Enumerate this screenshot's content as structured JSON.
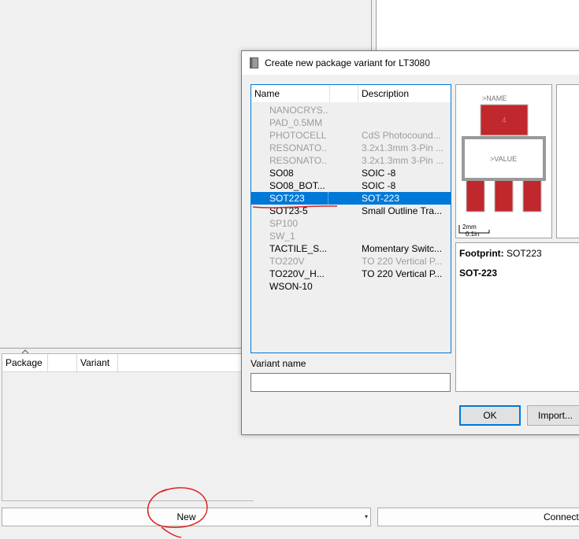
{
  "background": {
    "package_table": {
      "columns": [
        "Package",
        "",
        "Variant",
        ""
      ]
    },
    "new_combo": {
      "label": "New",
      "arrow": "▾"
    },
    "connect_button": {
      "label": "Connect"
    }
  },
  "dialog": {
    "title": "Create new package variant for LT3080",
    "columns": {
      "name": "Name",
      "spacer": "",
      "description": "Description"
    },
    "rows": [
      {
        "name": "NANOCRYS...",
        "description": "",
        "enabled": false
      },
      {
        "name": "PAD_0.5MM",
        "description": "",
        "enabled": false
      },
      {
        "name": "PHOTOCELL",
        "description": "CdS Photocound...",
        "enabled": false
      },
      {
        "name": "RESONATO...",
        "description": "3.2x1.3mm 3-Pin ...",
        "enabled": false
      },
      {
        "name": "RESONATO...",
        "description": "3.2x1.3mm 3-Pin ...",
        "enabled": false
      },
      {
        "name": "SO08",
        "description": "SOIC -8",
        "enabled": true
      },
      {
        "name": "SO08_BOT...",
        "description": "SOIC -8",
        "enabled": true
      },
      {
        "name": "SOT223",
        "description": "SOT-223",
        "enabled": true,
        "selected": true
      },
      {
        "name": "SOT23-5",
        "description": "Small Outline Tra...",
        "enabled": true
      },
      {
        "name": "SP100",
        "description": "",
        "enabled": false
      },
      {
        "name": "SW_1",
        "description": "",
        "enabled": false
      },
      {
        "name": "TACTILE_S...",
        "description": "Momentary Switc...",
        "enabled": true
      },
      {
        "name": "TO220V",
        "description": "TO 220 Vertical P...",
        "enabled": false
      },
      {
        "name": "TO220V_H...",
        "description": "TO 220 Vertical P...",
        "enabled": true
      },
      {
        "name": "WSON-10",
        "description": "",
        "enabled": true
      }
    ],
    "variant_name_label": "Variant name",
    "variant_name_value": "",
    "preview": {
      "name_label": ">NAME",
      "value_label": ">VALUE",
      "pad_number": "4",
      "scale_mm": "2mm",
      "scale_in": "0.1in",
      "pad_color": "#c0282d"
    },
    "info": {
      "footprint_label": "Footprint:",
      "footprint_value": "SOT223",
      "description": "SOT-223"
    },
    "ok_label": "OK",
    "import_label": "Import..."
  },
  "colors": {
    "selection": "#0078d7",
    "annotation": "#e02020"
  }
}
